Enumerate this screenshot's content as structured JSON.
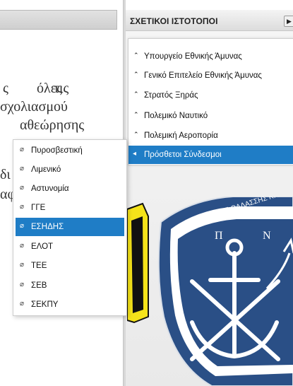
{
  "article": {
    "line1_w1": "ς",
    "line1_w2": "όλες",
    "line1_w3": "τις",
    "line2": "σχολιασμού",
    "line3": "αθεώρησης",
    "line4": "δι",
    "line5": "αφ"
  },
  "panel": {
    "title": "ΣΧΕΤΙΚΟΙ ΙΣΤΟΤΟΠΟΙ",
    "arrow": "▶"
  },
  "main_menu": {
    "items": [
      {
        "label": "Υπουργείο Εθνικής Άμυνας",
        "arrow": "⌃"
      },
      {
        "label": "Γενικό Επιτελείο Εθνικής Άμυνας",
        "arrow": "⌃"
      },
      {
        "label": "Στρατός Ξηράς",
        "arrow": "⌃"
      },
      {
        "label": "Πολεμικό Ναυτικό",
        "arrow": "⌃"
      },
      {
        "label": "Πολεμική Αεροπορία",
        "arrow": "⌃"
      },
      {
        "label": "Πρόσθετοι Σύνδεσμοι",
        "arrow": "◂"
      }
    ]
  },
  "sub_menu": {
    "link_icon": "⌀",
    "items": [
      {
        "label": "Πυροσβεστική"
      },
      {
        "label": "Λιμενικό"
      },
      {
        "label": "Αστυνομία"
      },
      {
        "label": "ΓΓΕ"
      },
      {
        "label": "ΕΣΗΔΗΣ"
      },
      {
        "label": "ΕΛΟΤ"
      },
      {
        "label": "ΤΕΕ"
      },
      {
        "label": "ΣΕΒ"
      },
      {
        "label": "ΣΕΚΠΥ"
      }
    ]
  },
  "navy_emblem": {
    "motto": "ΜΕΓΑ ΤΟ ΤΗΣ ΘΑΛΑΣΣΗΣ ΚΡΑΤΟΣ",
    "letter_left": "Π",
    "letter_right": "Ν"
  },
  "colors": {
    "highlight": "#1f7dc6",
    "navy_blue": "#2a4f86",
    "army_yellow": "#f5e31a"
  }
}
